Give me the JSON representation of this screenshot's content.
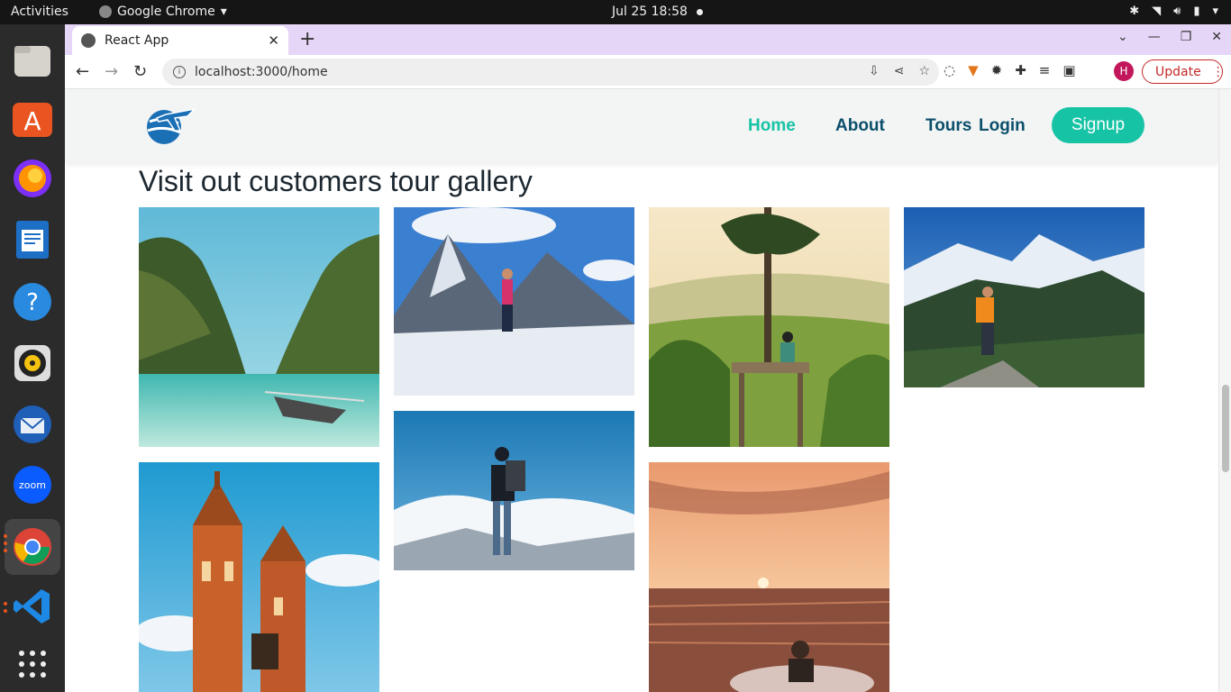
{
  "os": {
    "activities": "Activities",
    "app_menu": "Google Chrome",
    "clock": "Jul 25  18:58"
  },
  "browser": {
    "tab_title": "React App",
    "url": "localhost:3000/home",
    "avatar_letter": "H",
    "update_label": "Update"
  },
  "site": {
    "nav": {
      "home": "Home",
      "about": "About",
      "tours": "Tours",
      "login": "Login",
      "signup": "Signup"
    },
    "gallery_title": "Visit out customers tour gallery",
    "gallery": [
      {
        "name": "gallery-photo-tropical-lagoon"
      },
      {
        "name": "gallery-photo-snow-mountain-climber"
      },
      {
        "name": "gallery-photo-tree-platform-valley"
      },
      {
        "name": "gallery-photo-hiker-alpine-ridge"
      },
      {
        "name": "gallery-photo-backpacker-clouds"
      },
      {
        "name": "gallery-photo-gothic-cathedral"
      },
      {
        "name": "gallery-photo-sunset-sea"
      }
    ]
  },
  "colors": {
    "accent": "#17c3a5",
    "nav_text": "#0b4f6c",
    "tabstrip": "#e5d6f7"
  }
}
